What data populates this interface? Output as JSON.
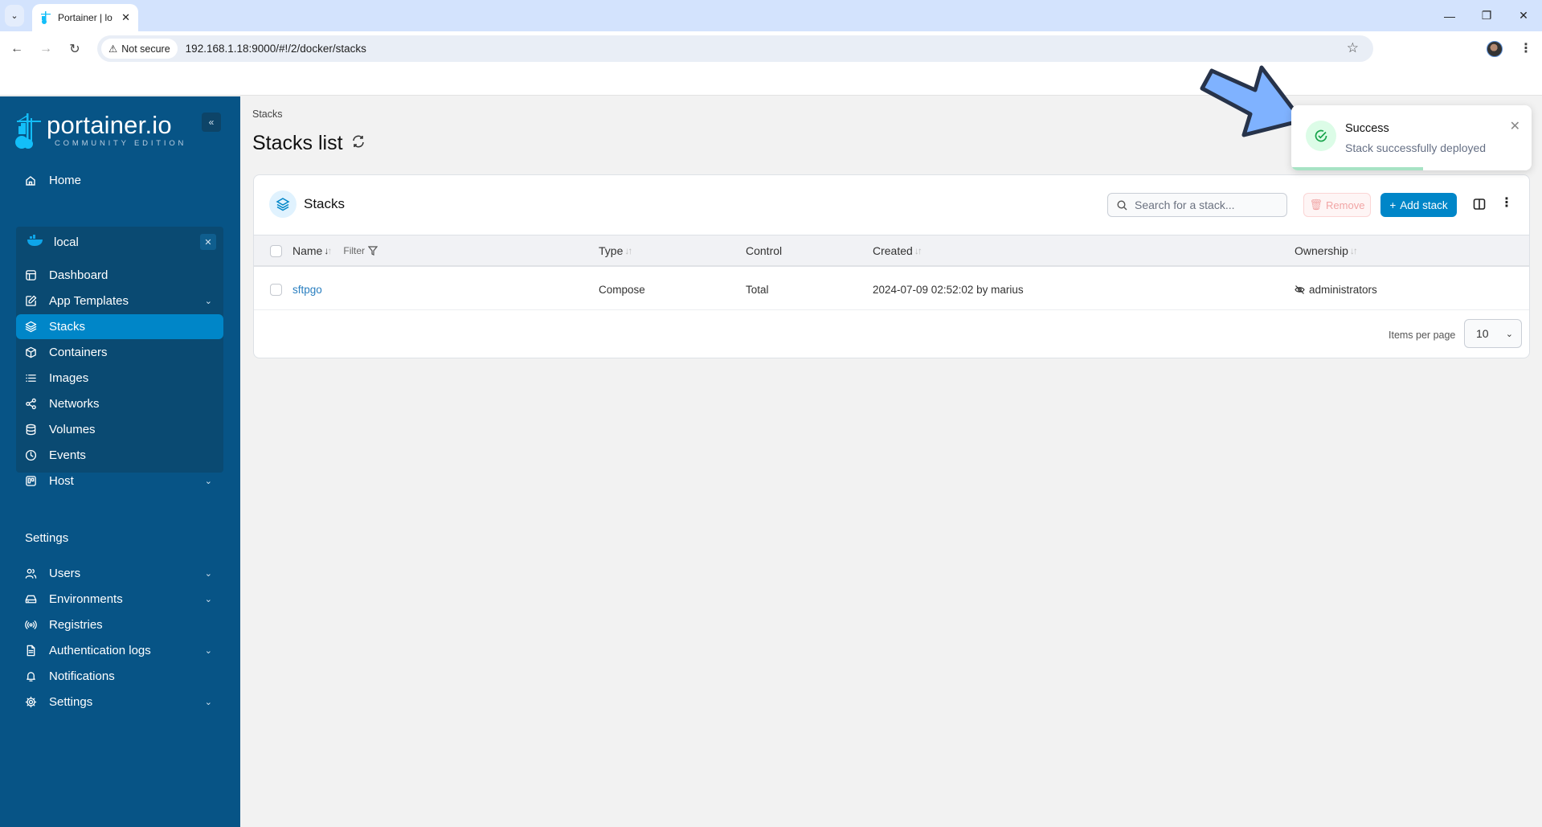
{
  "browser": {
    "tab_title": "Portainer | lo",
    "not_secure_label": "Not secure",
    "url": "192.168.1.18:9000/#!/2/docker/stacks"
  },
  "sidebar": {
    "logo_text": "portainer.io",
    "logo_subtitle": "COMMUNITY EDITION",
    "home_label": "Home",
    "environment": {
      "name": "local",
      "items": [
        {
          "label": "Dashboard",
          "icon": "dashboard-icon",
          "has_chevron": false
        },
        {
          "label": "App Templates",
          "icon": "edit-icon",
          "has_chevron": true
        },
        {
          "label": "Stacks",
          "icon": "layers-icon",
          "has_chevron": false,
          "active": true
        },
        {
          "label": "Containers",
          "icon": "box-icon",
          "has_chevron": false
        },
        {
          "label": "Images",
          "icon": "list-icon",
          "has_chevron": false
        },
        {
          "label": "Networks",
          "icon": "share-icon",
          "has_chevron": false
        },
        {
          "label": "Volumes",
          "icon": "database-icon",
          "has_chevron": false
        },
        {
          "label": "Events",
          "icon": "clock-icon",
          "has_chevron": false
        },
        {
          "label": "Host",
          "icon": "trello-icon",
          "has_chevron": true
        }
      ]
    },
    "settings_heading": "Settings",
    "settings_items": [
      {
        "label": "Users",
        "icon": "users-icon",
        "has_chevron": true
      },
      {
        "label": "Environments",
        "icon": "hard-drive-icon",
        "has_chevron": true
      },
      {
        "label": "Registries",
        "icon": "radio-icon",
        "has_chevron": false
      },
      {
        "label": "Authentication logs",
        "icon": "file-text-icon",
        "has_chevron": true
      },
      {
        "label": "Notifications",
        "icon": "bell-icon",
        "has_chevron": false
      },
      {
        "label": "Settings",
        "icon": "gear-icon",
        "has_chevron": true
      }
    ]
  },
  "main": {
    "breadcrumb": "Stacks",
    "title": "Stacks list",
    "card_title": "Stacks",
    "search_placeholder": "Search for a stack...",
    "remove_label": "Remove",
    "add_label": "Add stack",
    "columns": {
      "name": "Name",
      "filter": "Filter",
      "type": "Type",
      "control": "Control",
      "created": "Created",
      "ownership": "Ownership"
    },
    "rows": [
      {
        "name": "sftpgo",
        "type": "Compose",
        "control": "Total",
        "created": "2024-07-09 02:52:02 by marius",
        "ownership": "administrators"
      }
    ],
    "items_per_page_label": "Items per page",
    "items_per_page": "10"
  },
  "toast": {
    "title": "Success",
    "message": "Stack successfully deployed",
    "progress": 0.55
  },
  "colors": {
    "sidebar": "#075486",
    "accent": "#0086c8",
    "success": "#16a34a"
  }
}
